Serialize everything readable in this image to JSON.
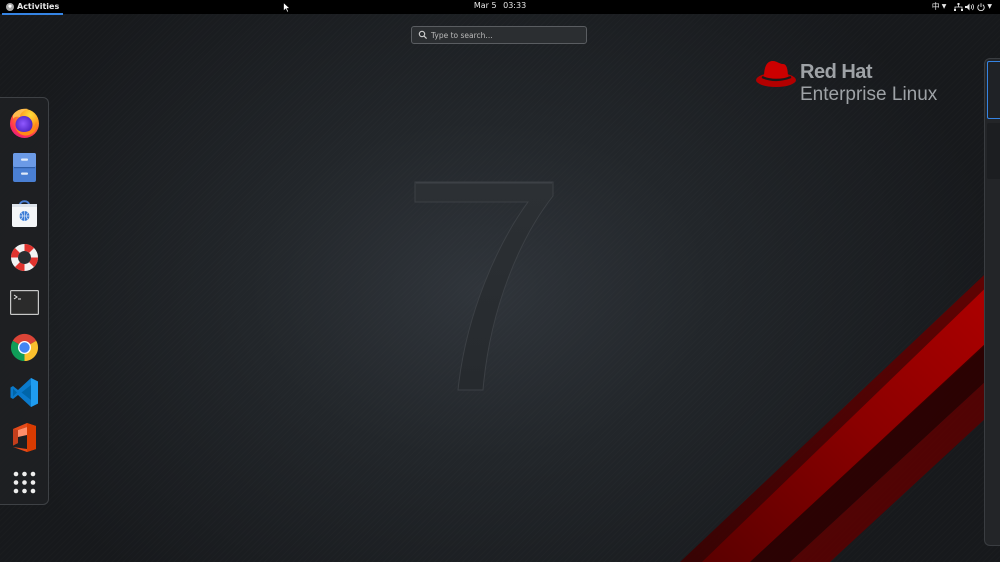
{
  "topbar": {
    "activities_label": "Activities",
    "clock_date": "Mar 5",
    "clock_time": "03:33",
    "input_method": "中",
    "tray_icons": [
      "network-icon",
      "volume-icon",
      "power-icon"
    ]
  },
  "search": {
    "placeholder": "Type to search..."
  },
  "branding": {
    "brand": "Red Hat",
    "product": "Enterprise Linux",
    "version_numeral": "7",
    "accent_color": "#cc0000"
  },
  "dash": {
    "apps": [
      {
        "name": "Firefox",
        "icon": "firefox-icon"
      },
      {
        "name": "Files",
        "icon": "file-cabinet-icon"
      },
      {
        "name": "Software",
        "icon": "software-bag-icon"
      },
      {
        "name": "Help",
        "icon": "lifebuoy-icon"
      },
      {
        "name": "Terminal",
        "icon": "terminal-icon"
      },
      {
        "name": "Google Chrome",
        "icon": "chrome-icon"
      },
      {
        "name": "Visual Studio Code",
        "icon": "vscode-icon"
      },
      {
        "name": "Office",
        "icon": "office-icon"
      },
      {
        "name": "Show Applications",
        "icon": "app-grid-icon"
      }
    ]
  },
  "workspaces": {
    "count": 2,
    "active_index": 0,
    "highlight_color": "#3584e4"
  }
}
